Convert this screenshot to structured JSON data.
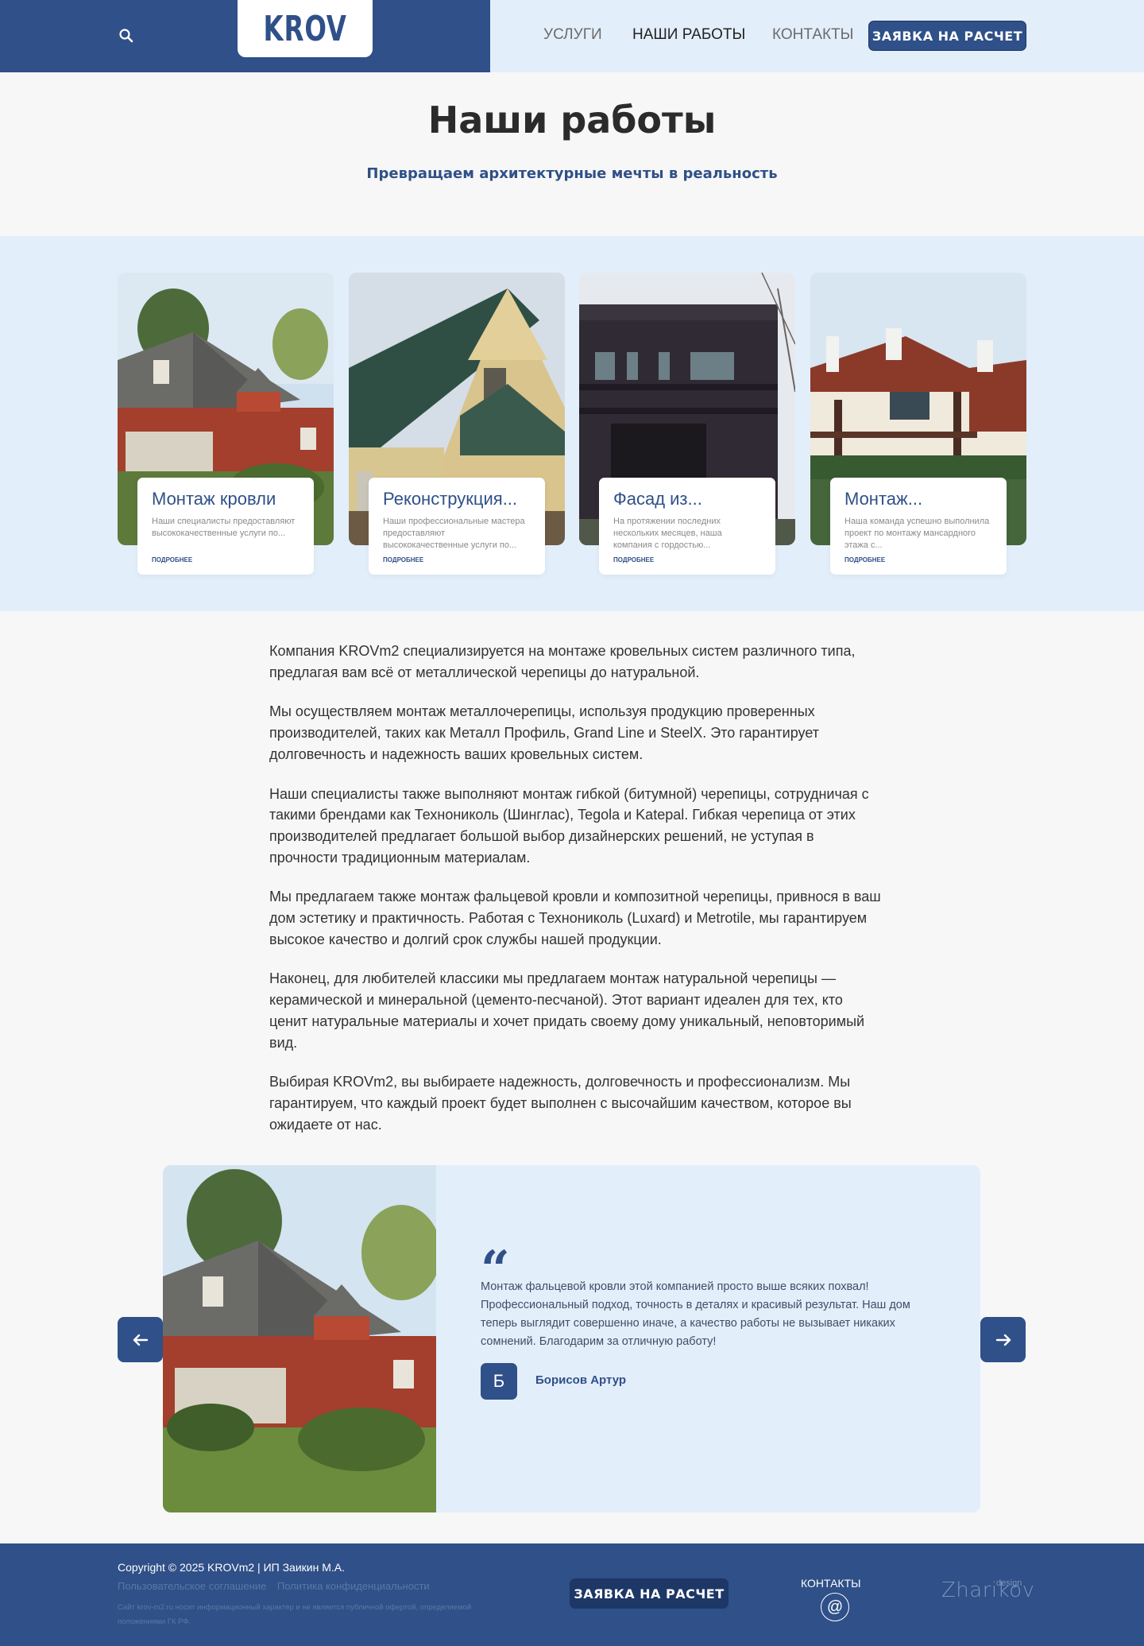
{
  "header": {
    "nav": {
      "services": "УСЛУГИ",
      "works": "НАШИ РАБОТЫ",
      "contacts": "КОНТАКТЫ"
    },
    "request_button": "ЗАЯВКА НА РАСЧЕТ",
    "logo": "KROV",
    "search_icon": "search-icon"
  },
  "hero": {
    "title": "Наши работы",
    "subtitle": "Превращаем архитектурные мечты в реальность"
  },
  "cards": [
    {
      "title": "Монтаж кровли",
      "description": "Наши специалисты предоставляют высококачественные услуги по...",
      "more": "ПОДРОБНЕЕ"
    },
    {
      "title": "Реконструкция...",
      "description": "Наши профессиональные мастера предоставляют высококачественные услуги по...",
      "more": "ПОДРОБНЕЕ"
    },
    {
      "title": "Фасад из...",
      "description": "На протяжении последних нескольких месяцев, наша компания с гордостью...",
      "more": "ПОДРОБНЕЕ"
    },
    {
      "title": "Монтаж...",
      "description": "Наша команда успешно выполнила проект по монтажу мансардного этажа с...",
      "more": "ПОДРОБНЕЕ"
    }
  ],
  "content": {
    "paragraphs": [
      "Компания KROVm2 специализируется на монтаже кровельных систем различного типа, предлагая вам всё от металлической черепицы до натуральной.",
      "Мы осуществляем монтаж металлочерепицы, используя продукцию проверенных производителей, таких как Металл Профиль, Grand Line и SteelX. Это гарантирует долговечность и надежность ваших кровельных систем.",
      "Наши специалисты также выполняют монтаж гибкой (битумной) черепицы, сотрудничая с такими брендами как Технониколь (Шинглас), Tegola и Katepal. Гибкая черепица от этих производителей предлагает большой выбор дизайнерских решений, не уступая в прочности традиционным материалам.",
      "Мы предлагаем также монтаж фальцевой кровли и композитной черепицы, привнося в ваш дом эстетику и практичность. Работая с Технониколь (Luxard) и Metrotile, мы гарантируем высокое качество и долгий срок службы нашей продукции.",
      "Наконец, для любителей классики мы предлагаем монтаж натуральной черепицы — керамической и минеральной (цементо-песчаной). Этот вариант идеален для тех, кто ценит натуральные материалы и хочет придать своему дому уникальный, неповторимый вид.",
      "Выбирая KROVm2, вы выбираете надежность, долговечность и профессионализм. Мы гарантируем, что каждый проект будет выполнен с высочайшим качеством, которое вы ожидаете от нас."
    ]
  },
  "review": {
    "quote_mark": "“",
    "text": "Монтаж фальцевой кровли этой компанией просто выше всяких похвал! Профессиональный подход, точность в деталях и красивый результат. Наш дом теперь выглядит совершенно иначе, а качество работы не вызывает никаких сомнений. Благодарим за отличную работу!",
    "avatar_letter": "Б",
    "author": "Борисов Артур",
    "prev_icon": "arrow-left-icon",
    "next_icon": "arrow-right-icon"
  },
  "footer": {
    "copyright": "Copyright © 2025 KROVm2 | ИП Заикин М.А.",
    "links": [
      "Пользовательское соглашение",
      "Политика конфиденциальности"
    ],
    "disclaimer": "Сайт krov-m2.ru носит информационный характер и не является публичной офертой, определяемой положениями ГК РФ.",
    "request_button": "ЗАЯВКА НА РАСЧЕТ",
    "contacts_label": "КОНТАКТЫ",
    "email_icon": "at-icon",
    "designer": "Zharikov",
    "designer_sup": "design"
  },
  "colors": {
    "brand": "#2f5088",
    "light_bg": "#e3eefb",
    "page_bg": "#f7f7f7"
  }
}
